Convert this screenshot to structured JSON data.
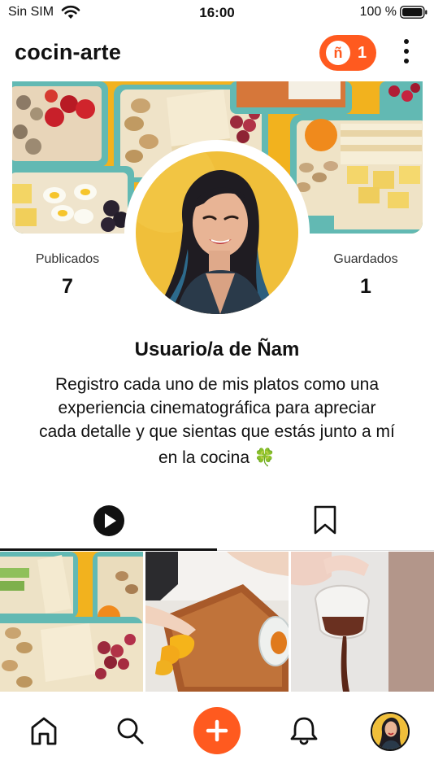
{
  "status_bar": {
    "carrier": "Sin SIM",
    "time": "16:00",
    "battery": "100 %"
  },
  "header": {
    "username": "cocin-arte",
    "coin_symbol": "ñ",
    "coin_count": "1",
    "brand_color": "#ff5a1f"
  },
  "stats": {
    "published_label": "Publicados",
    "published_value": "7",
    "saved_label": "Guardados",
    "saved_value": "1"
  },
  "profile": {
    "name": "Usuario/a de Ñam",
    "bio_lines": [
      "Registro cada uno de mis platos como una",
      "experiencia cinematográfica para apreciar",
      "cada detalle y que sientas que estás junto a mí",
      "en la cocina"
    ],
    "bio_emoji": "🍀"
  },
  "tabs": {
    "active": "videos",
    "icons": [
      "play-circle-icon",
      "bookmark-icon"
    ]
  },
  "bottom_nav": {
    "icons": [
      "home-icon",
      "search-icon",
      "plus-icon",
      "bell-icon",
      "avatar"
    ]
  }
}
